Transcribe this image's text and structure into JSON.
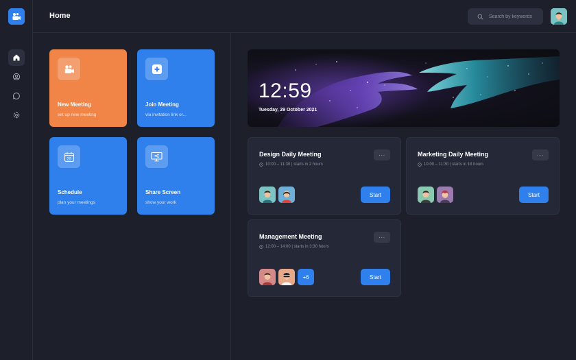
{
  "header": {
    "title": "Home",
    "search_placeholder": "Search by keywords"
  },
  "sidebar": {
    "items": [
      {
        "name": "home-icon",
        "active": true
      },
      {
        "name": "user-icon",
        "active": false
      },
      {
        "name": "chat-icon",
        "active": false
      },
      {
        "name": "settings-icon",
        "active": false
      }
    ]
  },
  "actions": [
    {
      "title": "New Meeting",
      "subtitle": "set up new meeting",
      "icon": "video-camera-icon",
      "color": "#f18447"
    },
    {
      "title": "Join Meeting",
      "subtitle": "via invitation link or...",
      "icon": "plus-icon",
      "color": "#2f80ed"
    },
    {
      "title": "Schedule",
      "subtitle": "plan your meetings",
      "icon": "calendar-icon",
      "calendar_day": "25",
      "color": "#2f80ed"
    },
    {
      "title": "Share Screen",
      "subtitle": "show your work",
      "icon": "monitor-share-icon",
      "color": "#2f80ed"
    }
  ],
  "banner": {
    "time": "12:59",
    "date": "Tuesday, 29 October 2021"
  },
  "meetings": [
    {
      "title": "Design Daily Meeting",
      "time": "10:00 – 11:30 | starts in 2 hours",
      "more": "···",
      "start_label": "Start"
    },
    {
      "title": "Marketing Daily Meeting",
      "time": "10:00 – 11:30 | starts in 18 hours",
      "more": "···",
      "start_label": "Start"
    },
    {
      "title": "Management Meeting",
      "time": "12:00 – 14:00 | starts in 3:30 hours",
      "more": "···",
      "start_label": "Start",
      "extra_count": "+6"
    }
  ],
  "colors": {
    "background": "#1d1f2b",
    "card": "#252836",
    "accent": "#2f80ed",
    "orange": "#f18447"
  }
}
